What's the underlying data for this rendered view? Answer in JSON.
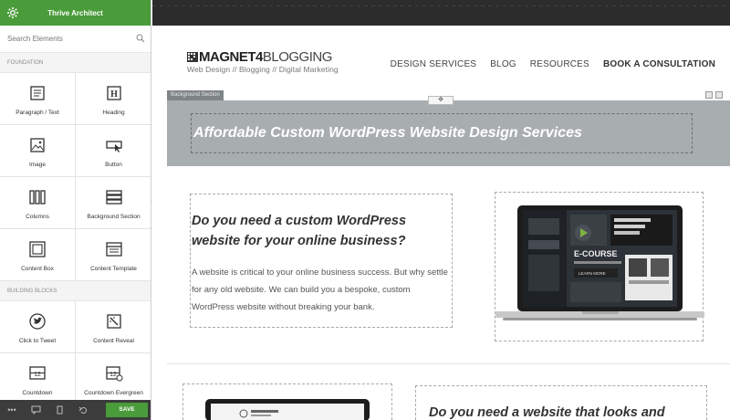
{
  "sidebar": {
    "title": "Thrive Architect",
    "search_placeholder": "Search Elements",
    "sections": [
      {
        "label": "FOUNDATION",
        "items": [
          {
            "label": "Paragraph / Text",
            "icon": "paragraph-icon"
          },
          {
            "label": "Heading",
            "icon": "heading-icon"
          },
          {
            "label": "Image",
            "icon": "image-icon"
          },
          {
            "label": "Button",
            "icon": "button-icon"
          },
          {
            "label": "Columns",
            "icon": "columns-icon"
          },
          {
            "label": "Background Section",
            "icon": "background-section-icon"
          },
          {
            "label": "Content Box",
            "icon": "content-box-icon"
          },
          {
            "label": "Content Template",
            "icon": "content-template-icon"
          }
        ]
      },
      {
        "label": "BUILDING BLOCKS",
        "items": [
          {
            "label": "Click to Tweet",
            "icon": "twitter-icon"
          },
          {
            "label": "Content Reveal",
            "icon": "content-reveal-icon"
          },
          {
            "label": "Countdown",
            "icon": "countdown-icon"
          },
          {
            "label": "Countdown Evergreen",
            "icon": "countdown-evergreen-icon"
          }
        ]
      }
    ],
    "footer": {
      "save_label": "SAVE"
    }
  },
  "site": {
    "logo_main": "MAGNET4",
    "logo_light": "BLOGGING",
    "logo_tagline": "Web Design // Blogging // Digital Marketing",
    "nav": [
      "DESIGN SERVICES",
      "BLOG",
      "RESOURCES",
      "BOOK A CONSULTATION"
    ]
  },
  "editor": {
    "section_label": "Background Section"
  },
  "hero": {
    "title": "Affordable Custom WordPress Website Design Services"
  },
  "row1": {
    "heading": "Do you need a custom WordPress website for your online business?",
    "body": "A website is critical to your online business success. But why settle for any old website. We can build you a bespoke, custom WordPress website without breaking your bank.",
    "laptop_text_1": "E-COURSE",
    "laptop_text_2": "LEARN MORE"
  },
  "row2": {
    "heading": "Do you need a website that looks and"
  },
  "colors": {
    "brand_green": "#4a9b3a",
    "hero_bg": "#a8aeb0"
  }
}
